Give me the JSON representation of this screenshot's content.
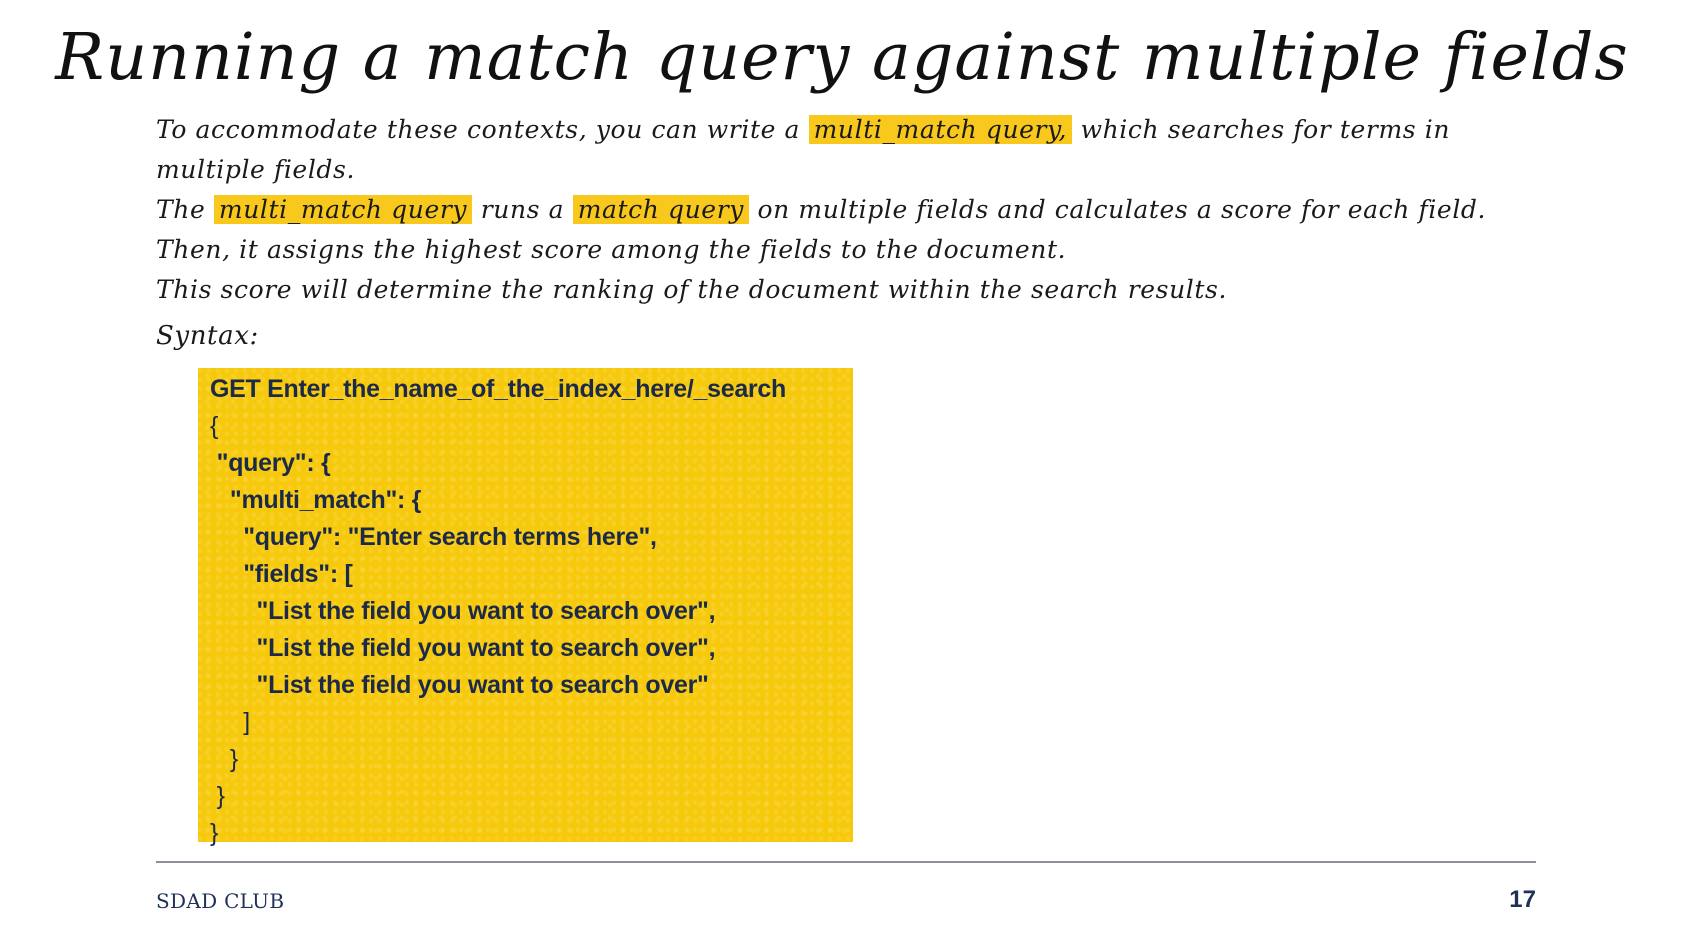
{
  "slide": {
    "title": "Running a match query against multiple fields",
    "paragraph": {
      "line1_before": "To accommodate these contexts, you can write a",
      "line1_highlight": "multi_match query,",
      "line1_after": "which searches for terms in",
      "line2": "multiple fields.",
      "line3_before": "The",
      "line3_highlight1": "multi_match query",
      "line3_middle": "runs a",
      "line3_highlight2": "match query",
      "line3_after": "on multiple fields and calculates a score for each field.",
      "line4": "Then, it assigns the highest score among the fields to the document.",
      "line5": "This score will determine the ranking of the document within the search results."
    },
    "syntax_label": "Syntax:",
    "code_lines": [
      "GET Enter_the_name_of_the_index_here/_search",
      "{",
      " \"query\": {",
      "   \"multi_match\": {",
      "     \"query\": \"Enter search terms here\",",
      "     \"fields\": [",
      "       \"List the field you want to search over\",",
      "       \"List the field you want to search over\",",
      "       \"List the field you want to search over\"",
      "     ]",
      "   }",
      " }",
      "}"
    ],
    "highlight_color": "#f8c81c",
    "code_background_color": "#f7c90c"
  },
  "footer": {
    "organization": "SDAD CLUB",
    "page_number": "17"
  }
}
